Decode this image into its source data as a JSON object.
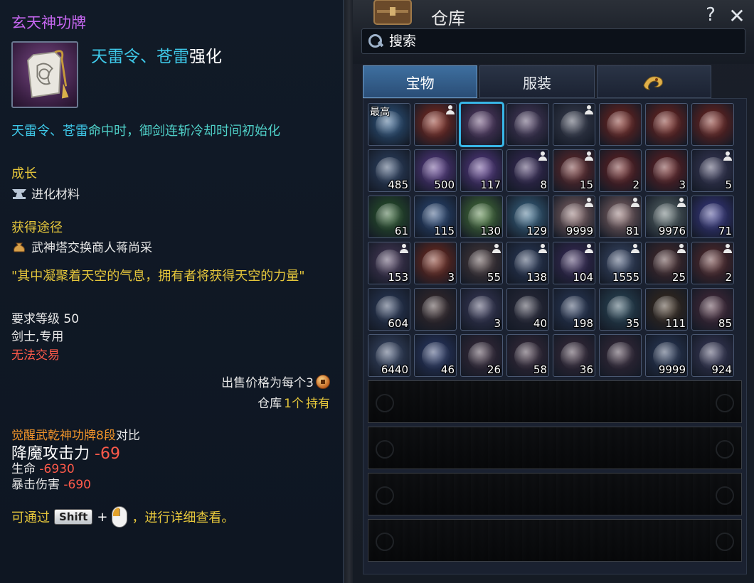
{
  "tooltip": {
    "title": "玄天神功牌",
    "enhance_cyan": "天雷令、苍雷",
    "enhance_white": "强化",
    "effect_cyan": "天雷令、苍雷",
    "effect_rest": "命中时，御剑连斩冷却时间初始化",
    "growth_header": "成长",
    "growth_item": "进化材料",
    "source_header": "获得途径",
    "source_item": "武神塔交换商人蒋尚采",
    "quote": "\"其中凝聚着天空的气息，拥有者将获得天空的力量\"",
    "level_req": "要求等级 50",
    "class_req": "剑士,专用",
    "trade": "无法交易",
    "sell_price": "出售价格为每个3",
    "storage_prefix": "仓库",
    "storage_count": "1个",
    "storage_suffix": "持有",
    "compare_name": "觉醒武乾神功牌8段",
    "compare_word": "对比",
    "stat1_label": "降魔攻击力",
    "stat1_value": "-69",
    "stat2_label": "生命",
    "stat2_value": "-6930",
    "stat3_label": "暴击伤害",
    "stat3_value": "-690",
    "hint_prefix": "可通过",
    "hint_key": "Shift",
    "hint_plus": "+",
    "hint_suffix": "，进行详细查看。"
  },
  "warehouse": {
    "title": "仓库",
    "help": "?",
    "close": "✕",
    "search_placeholder": "搜索",
    "tabs": [
      "宝物",
      "服装"
    ],
    "tab_icon": "dragon-emblem-icon",
    "slots": [
      {
        "icon": "bracelet-icon",
        "color": "#2f5a86",
        "label": "最高",
        "count": "",
        "bound": false
      },
      {
        "icon": "gauntlet-icon",
        "color": "#8a2a1c",
        "label": "",
        "count": "",
        "bound": true
      },
      {
        "icon": "talisman-icon",
        "color": "#5a3c6a",
        "label": "",
        "count": "",
        "bound": false,
        "selected": true
      },
      {
        "icon": "talisman-icon",
        "color": "#4a3a5e",
        "label": "",
        "count": "",
        "bound": false
      },
      {
        "icon": "plush-pet-icon",
        "color": "#3a3f50",
        "label": "",
        "count": "",
        "bound": true
      },
      {
        "icon": "green-flag-icon",
        "color": "#7a241c",
        "label": "",
        "count": "",
        "bound": false
      },
      {
        "icon": "green-flag-icon",
        "color": "#7a241c",
        "label": "",
        "count": "",
        "bound": false
      },
      {
        "icon": "green-flag-icon",
        "color": "#7a241c",
        "label": "",
        "count": "",
        "bound": false
      },
      {
        "icon": "key-icon",
        "color": "#2e4466",
        "label": "",
        "count": "485",
        "bound": false
      },
      {
        "icon": "scroll-icon",
        "color": "#5a3a8a",
        "label": "",
        "count": "500",
        "bound": false
      },
      {
        "icon": "scroll-icon",
        "color": "#5a3a8a",
        "label": "",
        "count": "117",
        "bound": false
      },
      {
        "icon": "purple-ore-icon",
        "color": "#3a2a5a",
        "label": "",
        "count": "8",
        "bound": true
      },
      {
        "icon": "silver-ore-icon",
        "color": "#6a2a2a",
        "label": "",
        "count": "15",
        "bound": true
      },
      {
        "icon": "red-ore-icon",
        "color": "#6a2020",
        "label": "",
        "count": "2",
        "bound": false
      },
      {
        "icon": "green-ore-icon",
        "color": "#6a2020",
        "label": "",
        "count": "3",
        "bound": false
      },
      {
        "icon": "crystal-icon",
        "color": "#3a3a5a",
        "label": "",
        "count": "5",
        "bound": true
      },
      {
        "icon": "green-talisman-icon",
        "color": "#2a5a2a",
        "label": "",
        "count": "61",
        "bound": false
      },
      {
        "icon": "blue-talisman-icon",
        "color": "#2a4a7a",
        "label": "",
        "count": "115",
        "bound": false
      },
      {
        "icon": "light-green-paper-icon",
        "color": "#4a7a3a",
        "label": "",
        "count": "130",
        "bound": false
      },
      {
        "icon": "blue-paper-icon",
        "color": "#3a6a8a",
        "label": "",
        "count": "129",
        "bound": false
      },
      {
        "icon": "scroll-map-icon",
        "color": "#8a6a6a",
        "label": "",
        "count": "9999",
        "bound": true
      },
      {
        "icon": "scroll-map-icon",
        "color": "#8a6a6a",
        "label": "",
        "count": "81",
        "bound": true
      },
      {
        "icon": "scroll-map-icon",
        "color": "#5a6a6a",
        "label": "",
        "count": "9976",
        "bound": true
      },
      {
        "icon": "blue-feather-icon",
        "color": "#3a3a8a",
        "label": "",
        "count": "71",
        "bound": false
      },
      {
        "icon": "beads-icon",
        "color": "#4a3a5a",
        "label": "",
        "count": "153",
        "bound": true
      },
      {
        "icon": "fire-orb-icon",
        "color": "#7a2a1a",
        "label": "",
        "count": "3",
        "bound": false
      },
      {
        "icon": "wing-icon",
        "color": "#4a3a3a",
        "label": "",
        "count": "55",
        "bound": true
      },
      {
        "icon": "dark-gem-icon",
        "color": "#2a3a5a",
        "label": "",
        "count": "138",
        "bound": true
      },
      {
        "icon": "gem-shard-icon",
        "color": "#3a2a5a",
        "label": "",
        "count": "104",
        "bound": true
      },
      {
        "icon": "ice-ore-icon",
        "color": "#3a4a6a",
        "label": "",
        "count": "1555",
        "bound": true
      },
      {
        "icon": "compass-icon",
        "color": "#4a2a2a",
        "label": "",
        "count": "25",
        "bound": true
      },
      {
        "icon": "dark-orb-icon",
        "color": "#5a2a2a",
        "label": "",
        "count": "2",
        "bound": true
      },
      {
        "icon": "dragon-coin-icon",
        "color": "#2a3a5a",
        "label": "",
        "count": "604",
        "bound": false
      },
      {
        "icon": "jade-disc-icon",
        "color": "#3a2a2a",
        "label": "",
        "count": "",
        "bound": false
      },
      {
        "icon": "flame-gem-icon",
        "color": "#3a3a5a",
        "label": "",
        "count": "3",
        "bound": false
      },
      {
        "icon": "dark-crystal-icon",
        "color": "#2a2a3a",
        "label": "",
        "count": "40",
        "bound": false
      },
      {
        "icon": "gold-coin-icon",
        "color": "#2a3a5a",
        "label": "",
        "count": "198",
        "bound": false
      },
      {
        "icon": "cyan-crystal-icon",
        "color": "#2a4a5a",
        "label": "",
        "count": "35",
        "bound": false
      },
      {
        "icon": "gold-knot-icon",
        "color": "#3a2a1a",
        "label": "",
        "count": "111",
        "bound": false
      },
      {
        "icon": "pouch-icon",
        "color": "#4a2a3a",
        "label": "",
        "count": "85",
        "bound": false
      },
      {
        "icon": "document-icon",
        "color": "#3a4a6a",
        "label": "",
        "count": "6440",
        "bound": false
      },
      {
        "icon": "key-box-icon",
        "color": "#2a3a6a",
        "label": "",
        "count": "46",
        "bound": false
      },
      {
        "icon": "red-orb-box-icon",
        "color": "#3a2a3a",
        "label": "",
        "count": "26",
        "bound": false
      },
      {
        "icon": "dark-box-icon",
        "color": "#3a2a3a",
        "label": "",
        "count": "58",
        "bound": false
      },
      {
        "icon": "dark-box-icon",
        "color": "#3a2a3a",
        "label": "",
        "count": "36",
        "bound": false
      },
      {
        "icon": "red-chest-icon",
        "color": "#3a2a3a",
        "label": "",
        "count": "",
        "bound": false
      },
      {
        "icon": "nut-basket-icon",
        "color": "#2a3a5a",
        "label": "",
        "count": "9999",
        "bound": false
      },
      {
        "icon": "nut-basket-icon",
        "color": "#3a3a5a",
        "label": "",
        "count": "924",
        "bound": false
      }
    ],
    "locked_rows": 4
  },
  "colors": {
    "title_purple": "#c667f0",
    "cyan": "#3ec8e8",
    "teal": "#4fd0c8",
    "yellow": "#e5c63b",
    "red": "#ff5a4a",
    "orange": "#f0942a",
    "selected_outline": "#38b6e6"
  }
}
